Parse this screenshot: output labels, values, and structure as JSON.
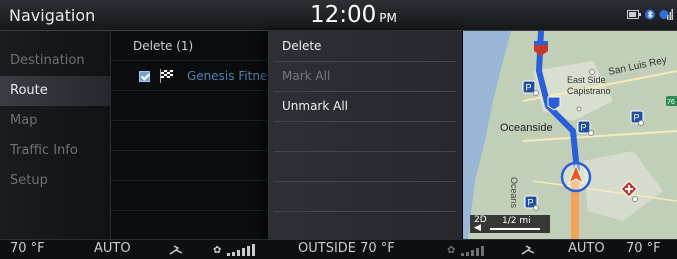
{
  "topbar": {
    "title": "Navigation",
    "time": "12:00",
    "ampm": "PM",
    "status_icons": [
      "battery-icon",
      "bluetooth-icon",
      "signal-icon"
    ]
  },
  "sidebar": {
    "items": [
      {
        "label": "Destination",
        "active": false
      },
      {
        "label": "Route",
        "active": true
      },
      {
        "label": "Map",
        "active": false
      },
      {
        "label": "Traffic Info",
        "active": false
      },
      {
        "label": "Setup",
        "active": false
      }
    ]
  },
  "list": {
    "header": "Delete (1)",
    "items": [
      {
        "label": "Genesis Fitne",
        "checked": true,
        "icon": "checkered-flag-icon"
      }
    ]
  },
  "menu": {
    "items": [
      {
        "label": "Delete",
        "enabled": true
      },
      {
        "label": "Mark All",
        "enabled": false
      },
      {
        "label": "Unmark All",
        "enabled": true
      }
    ]
  },
  "map": {
    "labels": {
      "san_luis_rey": "San Luis Rey",
      "east_side": "East Side",
      "capistrano": "Capistrano",
      "oceanside": "Oceanside",
      "oceanside_vertical": "Oceans",
      "route_76": "76"
    },
    "scale": {
      "mode": "2D",
      "distance": "1/2 mi"
    },
    "colors": {
      "route": "#2a5fd8",
      "road": "#f4a259",
      "water": "#99b6d6",
      "land": "#c2cfb8"
    }
  },
  "bottombar": {
    "left_temp": "70 °F",
    "left_mode": "AUTO",
    "outside": "OUTSIDE  70 °F",
    "right_mode": "AUTO",
    "right_temp": "70 °F"
  }
}
